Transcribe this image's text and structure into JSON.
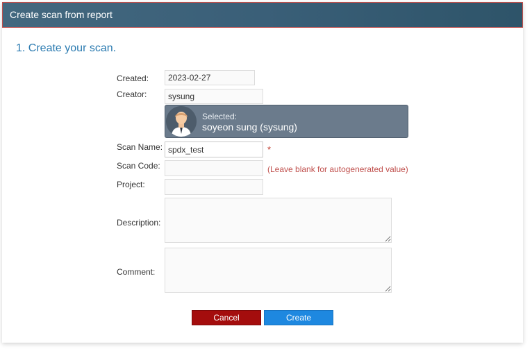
{
  "dialog": {
    "title": "Create scan from report"
  },
  "step": {
    "number": "1.",
    "title": "Create your scan."
  },
  "form": {
    "created": {
      "label": "Created:",
      "value": "2023-02-27"
    },
    "creator": {
      "label": "Creator:",
      "value": "sysung"
    },
    "selected_creator": {
      "label": "Selected:",
      "name": "soyeon sung (sysung)"
    },
    "scan_name": {
      "label": "Scan Name:",
      "value": "spdx_test",
      "required_mark": "*"
    },
    "scan_code": {
      "label": "Scan Code:",
      "value": "",
      "hint": "(Leave blank for autogenerated value)"
    },
    "project": {
      "label": "Project:",
      "value": ""
    },
    "description": {
      "label": "Description:",
      "value": ""
    },
    "comment": {
      "label": "Comment:",
      "value": ""
    }
  },
  "buttons": {
    "cancel": "Cancel",
    "create": "Create"
  },
  "colors": {
    "title_bar": "#3a5f78",
    "cancel": "#a40d0d",
    "create": "#1e88e0",
    "hint": "#c0504d",
    "heading": "#2a7ab0"
  }
}
